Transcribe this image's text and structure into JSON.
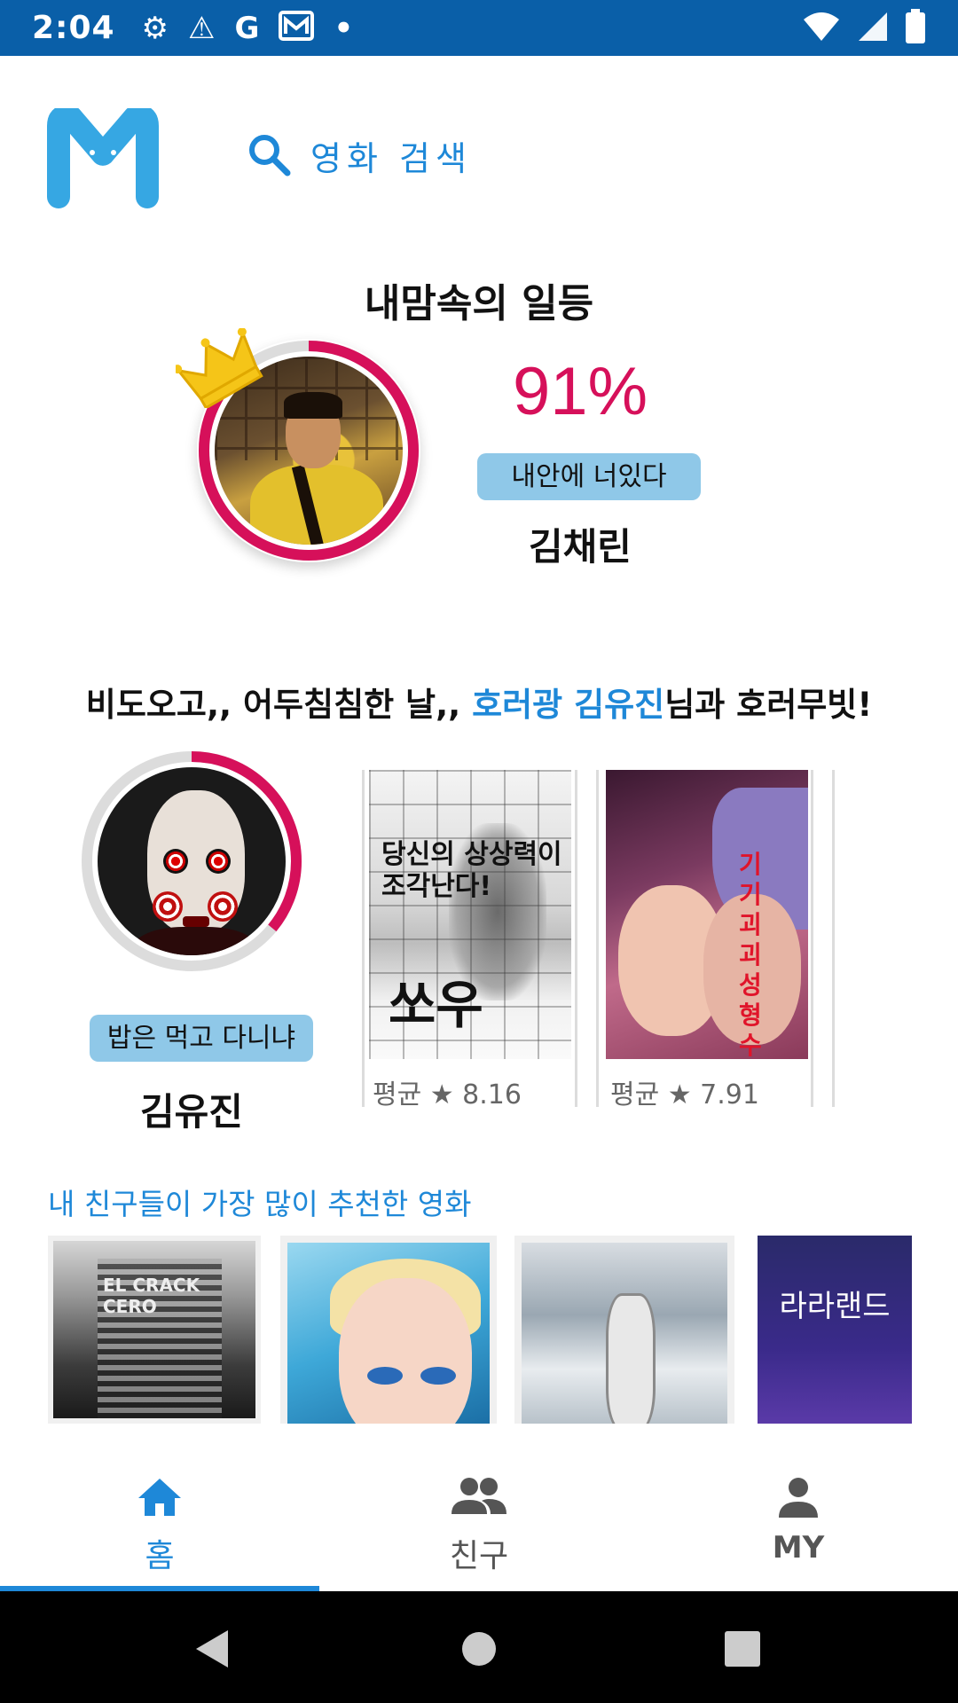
{
  "status_bar": {
    "time": "2:04",
    "icons": [
      "gear-icon",
      "warning-icon",
      "google-icon",
      "mail-icon",
      "dot-icon",
      "wifi-icon",
      "signal-icon",
      "battery-icon"
    ],
    "icon_glyphs": {
      "gear": "⚙",
      "warning": "⚠",
      "google": "G",
      "dot": "•"
    }
  },
  "header": {
    "logo": "M",
    "search_placeholder": "영화 검색"
  },
  "top_match": {
    "title": "내맘속의 일등",
    "percent": "91%",
    "percent_value": 91,
    "tag": "내안에 너있다",
    "name": "김채린"
  },
  "horror_section": {
    "title_prefix": "비도오고,, 어두침침한 날,, ",
    "title_highlight": "호러광 김유진",
    "title_suffix": "님과 호러무빗!",
    "friend": {
      "tag": "밥은 먹고 다니냐",
      "name": "김유진",
      "match_percent": 36
    },
    "movies": [
      {
        "poster_title": "쏘우",
        "poster_tagline": "당신의 상상력이 조각난다!",
        "rating": "평균 ★ 8.16"
      },
      {
        "poster_title": "기기괴괴 성형수",
        "rating": "평균 ★ 7.91"
      }
    ]
  },
  "friends_recommend": {
    "title": "내 친구들이 가장 많이 추천한 영화",
    "posters": [
      {
        "text": "EL CRACK CERO"
      },
      {
        "text": ""
      },
      {
        "text": ""
      },
      {
        "text": "라라랜드"
      }
    ]
  },
  "bottom_nav": {
    "items": [
      {
        "label": "홈",
        "icon": "home-icon",
        "active": true
      },
      {
        "label": "친구",
        "icon": "friends-icon",
        "active": false
      },
      {
        "label": "MY",
        "icon": "person-icon",
        "active": false
      }
    ]
  },
  "colors": {
    "accent_blue": "#1e88d8",
    "status_bar": "#0a5fa8",
    "ring_red": "#d6105a",
    "badge_blue": "#8fc8e8"
  }
}
